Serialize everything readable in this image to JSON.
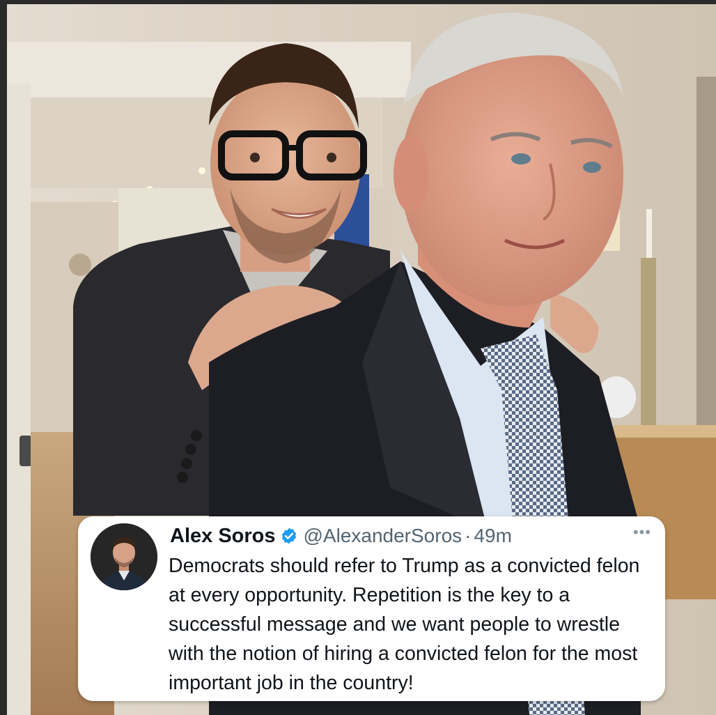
{
  "tweet": {
    "display_name": "Alex Soros",
    "handle": "@AlexanderSoros",
    "separator": "·",
    "time": "49m",
    "more_label": "•••",
    "text": "Democrats should refer to Trump as a convicted felon at every opportunity. Repetition is the key to a successful message and we want people to wrestle with the notion of hiring a convicted felon for the most important job in the country!",
    "verified_color": "#1d9bf0"
  },
  "icons": {
    "verified": "verified-badge-icon",
    "more": "more-options-icon",
    "avatar": "avatar"
  }
}
